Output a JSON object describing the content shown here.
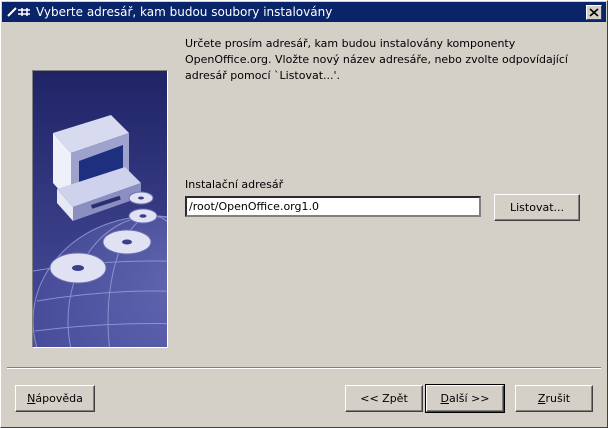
{
  "window": {
    "title": "Vyberte adresář, kam budou soubory instalovány"
  },
  "intro_text": "Určete prosím adresář, kam budou instalovány komponenty\nOpenOffice.org. Vložte nový název adresáře, nebo zvolte odpovídající\nadresář pomocí `Listovat...'.",
  "install": {
    "label": "Instalační adresář",
    "path": "/root/OpenOffice.org1.0",
    "browse": "Listovat..."
  },
  "buttons": {
    "help_u": "N",
    "help_rest": "ápověda",
    "back": "<< Zpět",
    "next_u": "D",
    "next_rest": "alší >>",
    "cancel_u": "Z",
    "cancel_rest": "rušit"
  },
  "colors": {
    "titlebar": "#0a246a",
    "dialog": "#d4d0c8",
    "art_bg": "#3a3f8a"
  }
}
